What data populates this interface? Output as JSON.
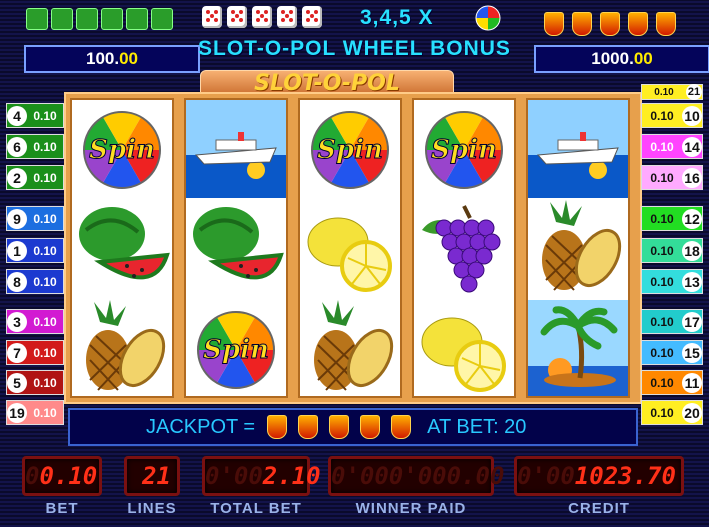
{
  "top": {
    "left_amount_int": "100.",
    "left_amount_dec": "00",
    "right_amount_int": "1000.",
    "right_amount_dec": "00",
    "multiplier_text": "3,4,5 X",
    "bonus_text": "SLOT-O-POL  WHEEL BONUS"
  },
  "title": "SLOT-O-POL",
  "reels": [
    [
      "spin-wheel",
      "melon",
      "pineapple"
    ],
    [
      "ship",
      "melon",
      "spin-wheel"
    ],
    [
      "spin-wheel",
      "lemon",
      "pineapple"
    ],
    [
      "spin-wheel",
      "grapes",
      "lemon"
    ],
    [
      "ship",
      "pineapple",
      "palm-island"
    ]
  ],
  "spin_text": "Spin",
  "left_lines": [
    {
      "num": "4",
      "val": "0.10",
      "color": "#1a8f1a"
    },
    {
      "num": "6",
      "val": "0.10",
      "color": "#1a8f1a"
    },
    {
      "num": "2",
      "val": "0.10",
      "color": "#1a8f1a"
    },
    {
      "num": "9",
      "val": "0.10",
      "color": "#1c6ee0"
    },
    {
      "num": "1",
      "val": "0.10",
      "color": "#1c3ad0"
    },
    {
      "num": "8",
      "val": "0.10",
      "color": "#1c3ad0"
    },
    {
      "num": "3",
      "val": "0.10",
      "color": "#d21ad2"
    },
    {
      "num": "7",
      "val": "0.10",
      "color": "#d21a1a"
    },
    {
      "num": "5",
      "val": "0.10",
      "color": "#b01414"
    },
    {
      "num": "19",
      "val": "0.10",
      "color": "#ff8a8a"
    }
  ],
  "right_lines": [
    {
      "num": "21",
      "val": "0.10",
      "color": "#ffee22"
    },
    {
      "num": "10",
      "val": "0.10",
      "color": "#ffee22"
    },
    {
      "num": "14",
      "val": "0.10",
      "color": "#ff44ff"
    },
    {
      "num": "16",
      "val": "0.10",
      "color": "#ffaaff"
    },
    {
      "num": "12",
      "val": "0.10",
      "color": "#22dd22"
    },
    {
      "num": "18",
      "val": "0.10",
      "color": "#33dd99"
    },
    {
      "num": "13",
      "val": "0.10",
      "color": "#33dddd"
    },
    {
      "num": "17",
      "val": "0.10",
      "color": "#22cccc"
    },
    {
      "num": "15",
      "val": "0.10",
      "color": "#44bbff"
    },
    {
      "num": "11",
      "val": "0.10",
      "color": "#ff8800"
    },
    {
      "num": "20",
      "val": "0.10",
      "color": "#ffee22"
    }
  ],
  "jackpot": {
    "label": "JACKPOT =",
    "bet_text": "AT BET: 20"
  },
  "displays": {
    "bet": {
      "ghost": "0",
      "value": "0.10",
      "label": "BET"
    },
    "lines": {
      "ghost": "",
      "value": "21",
      "label": "LINES"
    },
    "total_bet": {
      "ghost": "0'00",
      "value": "2.10",
      "label": "TOTAL BET"
    },
    "winner_paid": {
      "ghost": "0'000'000.00",
      "value": "",
      "label": "WINNER  PAID"
    },
    "credit": {
      "ghost": "0'00",
      "value": "1023.70",
      "label": "CREDIT"
    }
  },
  "colors": {
    "bonus_text": "#28e0ff",
    "lcd": "#ff3018",
    "jackpot_text": "#28c8ff"
  }
}
